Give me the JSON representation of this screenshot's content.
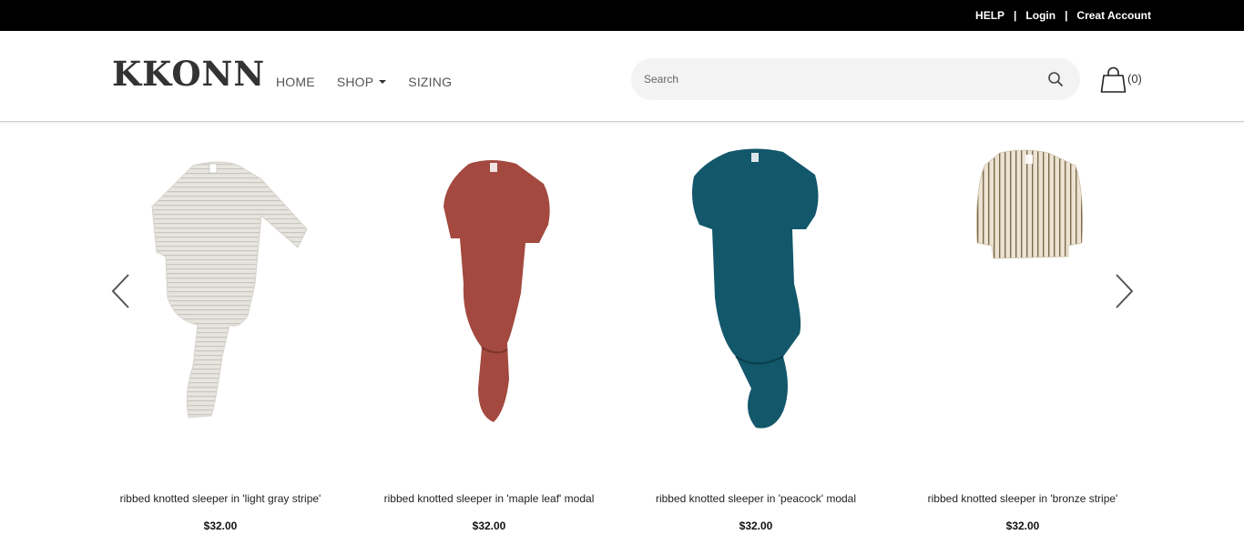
{
  "topbar": {
    "help": "HELP",
    "separator": "|",
    "login": "Login",
    "create_account": "Creat Account"
  },
  "header": {
    "logo": "KKONN",
    "nav": {
      "home": "HOME",
      "shop": "SHOP",
      "sizing": "SIZING"
    },
    "search": {
      "placeholder": "Search",
      "icon": "search-icon"
    },
    "cart": {
      "icon": "shopping-bag-icon",
      "count": "(0)"
    }
  },
  "carousel": {
    "prev_icon": "chevron-left-icon",
    "next_icon": "chevron-right-icon",
    "products": [
      {
        "name": "ribbed knotted sleeper in 'light gray stripe'",
        "price": "$32.00",
        "color": "#e7e5df",
        "stripe": "#c9c6bf",
        "style": "sleeper"
      },
      {
        "name": "ribbed knotted sleeper in 'maple leaf' modal",
        "price": "$32.00",
        "color": "#a3493f",
        "style": "sleeper"
      },
      {
        "name": "ribbed knotted sleeper in 'peacock' modal",
        "price": "$32.00",
        "color": "#13576b",
        "style": "sleeper"
      },
      {
        "name": "ribbed knotted sleeper in 'bronze stripe'",
        "price": "$32.00",
        "color": "#ece3d2",
        "stripe": "#7a6a4d",
        "style": "tee"
      }
    ]
  }
}
